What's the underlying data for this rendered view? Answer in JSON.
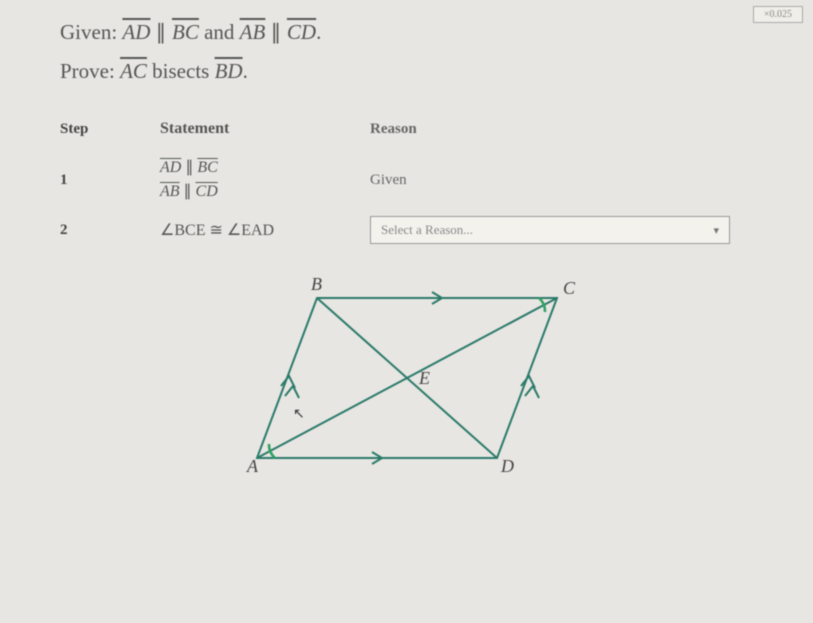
{
  "top_badge": "×0.025",
  "given": {
    "label": "Given:",
    "seg1a": "AD",
    "seg1b": "BC",
    "conj": "and",
    "seg2a": "AB",
    "seg2b": "CD",
    "end": "."
  },
  "prove": {
    "label": "Prove:",
    "seg1": "AC",
    "verb": "bisects",
    "seg2": "BD",
    "end": "."
  },
  "table": {
    "headers": {
      "step": "Step",
      "statement": "Statement",
      "reason": "Reason"
    },
    "rows": [
      {
        "step": "1",
        "statement_lines": [
          {
            "a": "AD",
            "sym": "∥",
            "b": "BC"
          },
          {
            "a": "AB",
            "sym": "∥",
            "b": "CD"
          }
        ],
        "reason_text": "Given"
      },
      {
        "step": "2",
        "statement_angle": {
          "a": "BCE",
          "sym": "≅",
          "b": "EAD"
        },
        "reason_select_placeholder": "Select a Reason..."
      }
    ]
  },
  "figure": {
    "labels": {
      "A": "A",
      "B": "B",
      "C": "C",
      "D": "D",
      "E": "E"
    }
  }
}
